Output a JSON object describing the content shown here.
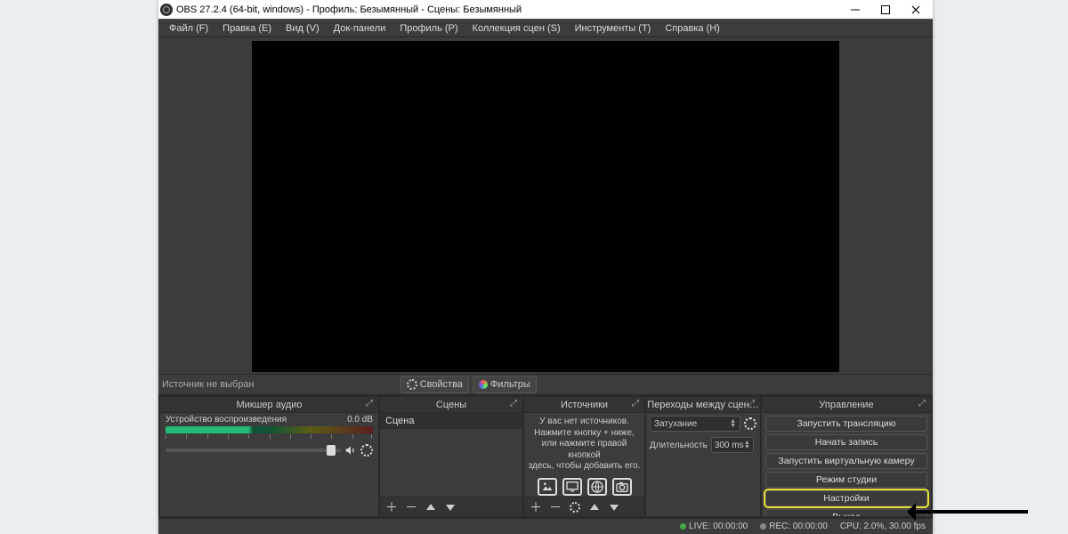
{
  "title": "OBS 27.2.4 (64-bit, windows) - Профиль: Безымянный - Сцены: Безымянный",
  "menu": {
    "file": "Файл (F)",
    "edit": "Правка (E)",
    "view": "Вид (V)",
    "docks": "Док-панели",
    "profile": "Профиль (P)",
    "scene_collection": "Коллекция сцен (S)",
    "tools": "Инструменты (T)",
    "help": "Справка (H)"
  },
  "toolbar": {
    "no_source": "Источник не выбран",
    "properties": "Свойства",
    "filters": "Фильтры"
  },
  "docks": {
    "audio": {
      "title": "Микшер аудио"
    },
    "scenes": {
      "title": "Сцены"
    },
    "sources": {
      "title": "Источники"
    },
    "transitions": {
      "title": "Переходы между сцен…"
    },
    "controls": {
      "title": "Управление"
    }
  },
  "audio": {
    "device": "Устройство воспроизведения",
    "level": "0.0 dB"
  },
  "scenes": {
    "items": [
      "Сцена"
    ]
  },
  "sources": {
    "empty_line1": "У вас нет источников.",
    "empty_line2": "Нажмите кнопку + ниже,",
    "empty_line3": "или нажмите правой кнопкой",
    "empty_line4": "здесь, чтобы добавить его."
  },
  "transitions": {
    "selected": "Затухание",
    "duration_label": "Длительность",
    "duration_value": "300 ms"
  },
  "controls": {
    "start_stream": "Запустить трансляцию",
    "start_record": "Начать запись",
    "start_vcam": "Запустить виртуальную камеру",
    "studio_mode": "Режим студии",
    "settings": "Настройки",
    "exit": "Выход"
  },
  "status": {
    "live": "LIVE: 00:00:00",
    "rec": "REC: 00:00:00",
    "cpu": "CPU: 2.0%, 30.00 fps"
  }
}
